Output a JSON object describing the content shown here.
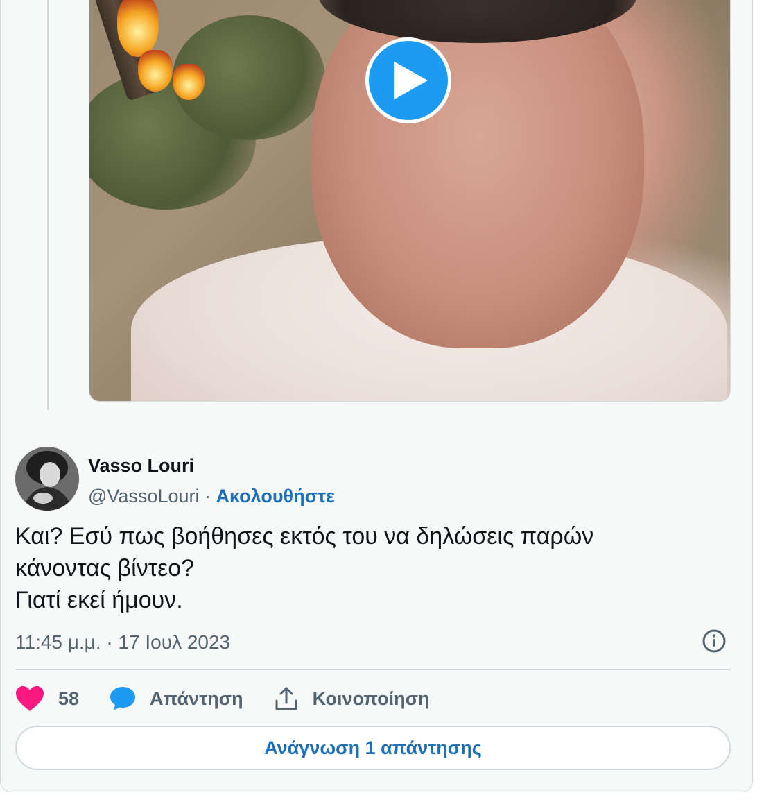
{
  "tweet": {
    "author_name": "Vasso Louri",
    "author_handle": "@VassoLouri",
    "separator": "·",
    "follow_label": "Ακολουθήστε",
    "text_lines": [
      "Και? Εσύ πως βοήθησες εκτός του να δηλώσεις παρών",
      "κάνοντας βίντεο?",
      "Γιατί εκεί ήμουν."
    ],
    "timestamp": "11:45 μ.μ. · 17 Ιουλ 2023"
  },
  "actions": {
    "like_count": "58",
    "reply_label": "Απάντηση",
    "share_label": "Κοινοποίηση"
  },
  "read_replies_label": "Ανάγνωση 1 απάντησης",
  "icons": {
    "play": "play-icon",
    "info": "info-icon",
    "heart": "heart-icon",
    "reply": "reply-bubble-icon",
    "share": "share-icon"
  },
  "colors": {
    "accent_blue": "#1d9bf0",
    "link_blue": "#1d6fb8",
    "heart_pink": "#f91880",
    "secondary_text": "#536471",
    "primary_text": "#0f1419"
  }
}
